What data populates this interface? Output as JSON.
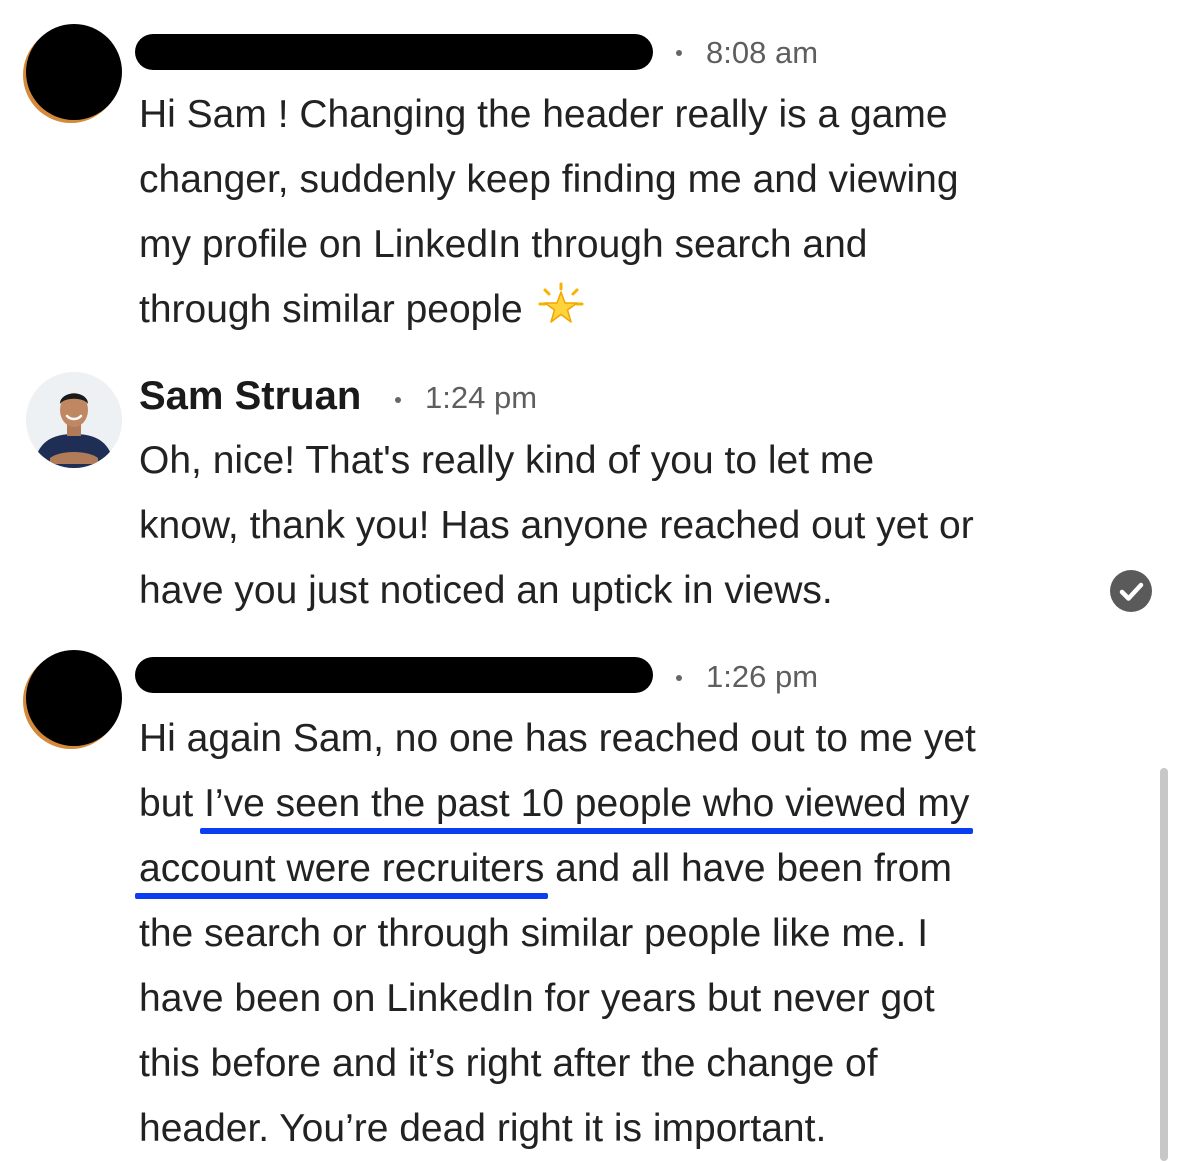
{
  "conversation": {
    "messages": [
      {
        "sender": "",
        "sender_redacted": true,
        "separator": "·",
        "time": "8:08 am",
        "lines": [
          "Hi Sam ! Changing the header really is a game",
          "changer, suddenly keep finding me and viewing",
          "my profile on LinkedIn through search and",
          "through similar people"
        ],
        "emoji": "glowing-star-icon"
      },
      {
        "sender": "Sam Struan",
        "sender_redacted": false,
        "separator": "·",
        "time": "1:24 pm",
        "lines": [
          "Oh, nice! That's really kind of you to let me",
          "know, thank you! Has anyone reached out yet or",
          "have you just noticed an uptick in views."
        ],
        "status_icon": "read-checkmark-icon"
      },
      {
        "sender": "",
        "sender_redacted": true,
        "separator": "·",
        "time": "1:26 pm",
        "line1": "Hi again Sam, no one has reached out to me yet",
        "line2_pre": "but ",
        "line2_mark": "I’ve seen the past 10 people who viewed my",
        "line3_mark": "account were recruiters",
        "line3_post": " and all have been from",
        "line4": "the search or through similar people like me. I",
        "line5": "have been on LinkedIn for years but never got",
        "line6": "this before and it’s right after the change of",
        "line7": "header. You’re dead right it is important."
      }
    ]
  },
  "colors": {
    "underline": "#0b3ef0",
    "redaction": "#000000",
    "timestamp": "#5e5e5e"
  }
}
